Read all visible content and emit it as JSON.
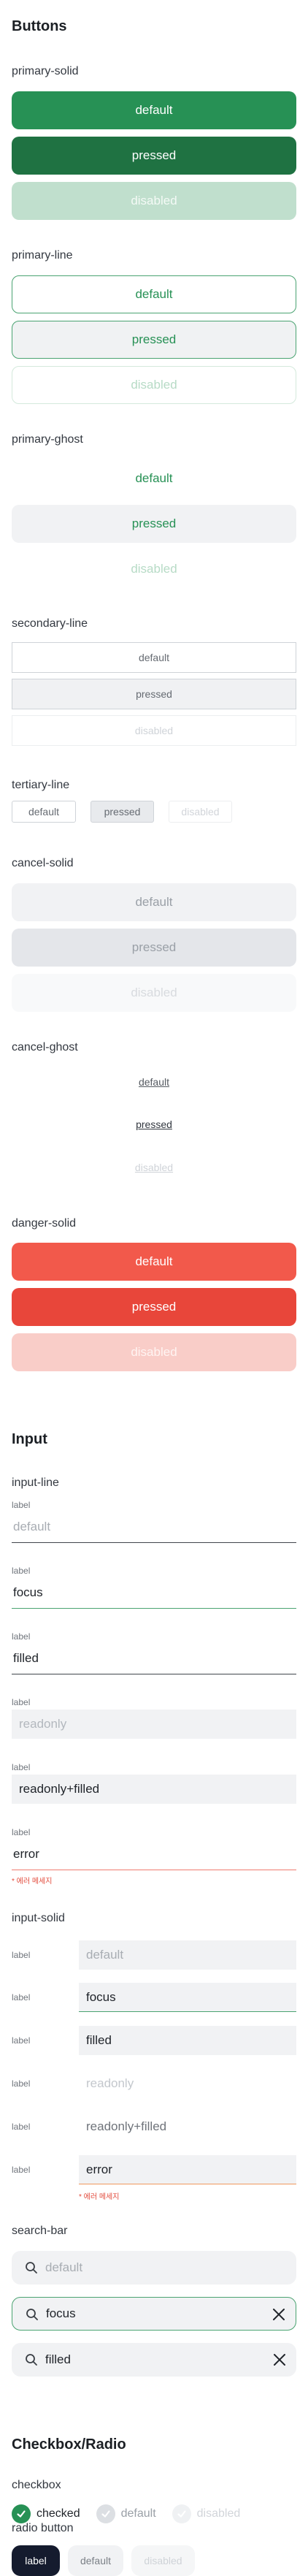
{
  "buttons": {
    "title": "Buttons",
    "primary_solid": {
      "label": "primary-solid",
      "default": "default",
      "pressed": "pressed",
      "disabled": "disabled"
    },
    "primary_line": {
      "label": "primary-line",
      "default": "default",
      "pressed": "pressed",
      "disabled": "disabled"
    },
    "primary_ghost": {
      "label": "primary-ghost",
      "default": "default",
      "pressed": "pressed",
      "disabled": "disabled"
    },
    "secondary_line": {
      "label": "secondary-line",
      "default": "default",
      "pressed": "pressed",
      "disabled": "disabled"
    },
    "tertiary_line": {
      "label": "tertiary-line",
      "default": "default",
      "pressed": "pressed",
      "disabled": "disabled"
    },
    "cancel_solid": {
      "label": "cancel-solid",
      "default": "default",
      "pressed": "pressed",
      "disabled": "disabled"
    },
    "cancel_ghost": {
      "label": "cancel-ghost",
      "default": "default",
      "pressed": "pressed",
      "disabled": "disabled"
    },
    "danger_solid": {
      "label": "danger-solid",
      "default": "default",
      "pressed": "pressed",
      "disabled": "disabled"
    }
  },
  "input": {
    "title": "Input",
    "input_line": {
      "label": "input-line",
      "fields": [
        {
          "label": "label",
          "value": "default",
          "state": "default"
        },
        {
          "label": "label",
          "value": "focus",
          "state": "focus"
        },
        {
          "label": "label",
          "value": "filled",
          "state": "filled"
        },
        {
          "label": "label",
          "value": "readonly",
          "state": "readonly"
        },
        {
          "label": "label",
          "value": "readonly+filled",
          "state": "readonly-filled"
        },
        {
          "label": "label",
          "value": "error",
          "state": "error",
          "error_message": "* 에러 메세지"
        }
      ]
    },
    "input_solid": {
      "label": "input-solid",
      "fields": [
        {
          "label": "label",
          "value": "default",
          "state": "default"
        },
        {
          "label": "label",
          "value": "focus",
          "state": "focus"
        },
        {
          "label": "label",
          "value": "filled",
          "state": "filled"
        },
        {
          "label": "label",
          "value": "readonly",
          "state": "readonly"
        },
        {
          "label": "label",
          "value": "readonly+filled",
          "state": "readonly-filled"
        },
        {
          "label": "label",
          "value": "error",
          "state": "error",
          "error_message": "* 에러 메세지"
        }
      ]
    },
    "search_bar": {
      "label": "search-bar",
      "items": [
        {
          "value": "default",
          "state": "default",
          "icon": "search-icon"
        },
        {
          "value": "focus",
          "state": "focus",
          "icon": "search-icon",
          "clear_icon": "close-icon"
        },
        {
          "value": "filled",
          "state": "filled",
          "icon": "search-icon",
          "clear_icon": "close-icon"
        }
      ]
    }
  },
  "checkbox_radio": {
    "title": "Checkbox/Radio",
    "checkbox": {
      "label": "checkbox",
      "items": [
        {
          "label": "checked",
          "state": "checked",
          "icon": "check-circle-icon"
        },
        {
          "label": "default",
          "state": "default",
          "icon": "check-circle-icon"
        },
        {
          "label": "disabled",
          "state": "disabled",
          "icon": "check-circle-icon"
        }
      ]
    },
    "radio_button": {
      "label": "radio button",
      "items": [
        {
          "label": "label",
          "state": "selected"
        },
        {
          "label": "default",
          "state": "default"
        },
        {
          "label": "disabled",
          "state": "disabled"
        }
      ]
    }
  },
  "colors": {
    "primary": "#279155",
    "primary_pressed": "#1f7242",
    "danger": "#f2594b",
    "error": "#e24a3b",
    "radio_selected": "#151b2e"
  }
}
